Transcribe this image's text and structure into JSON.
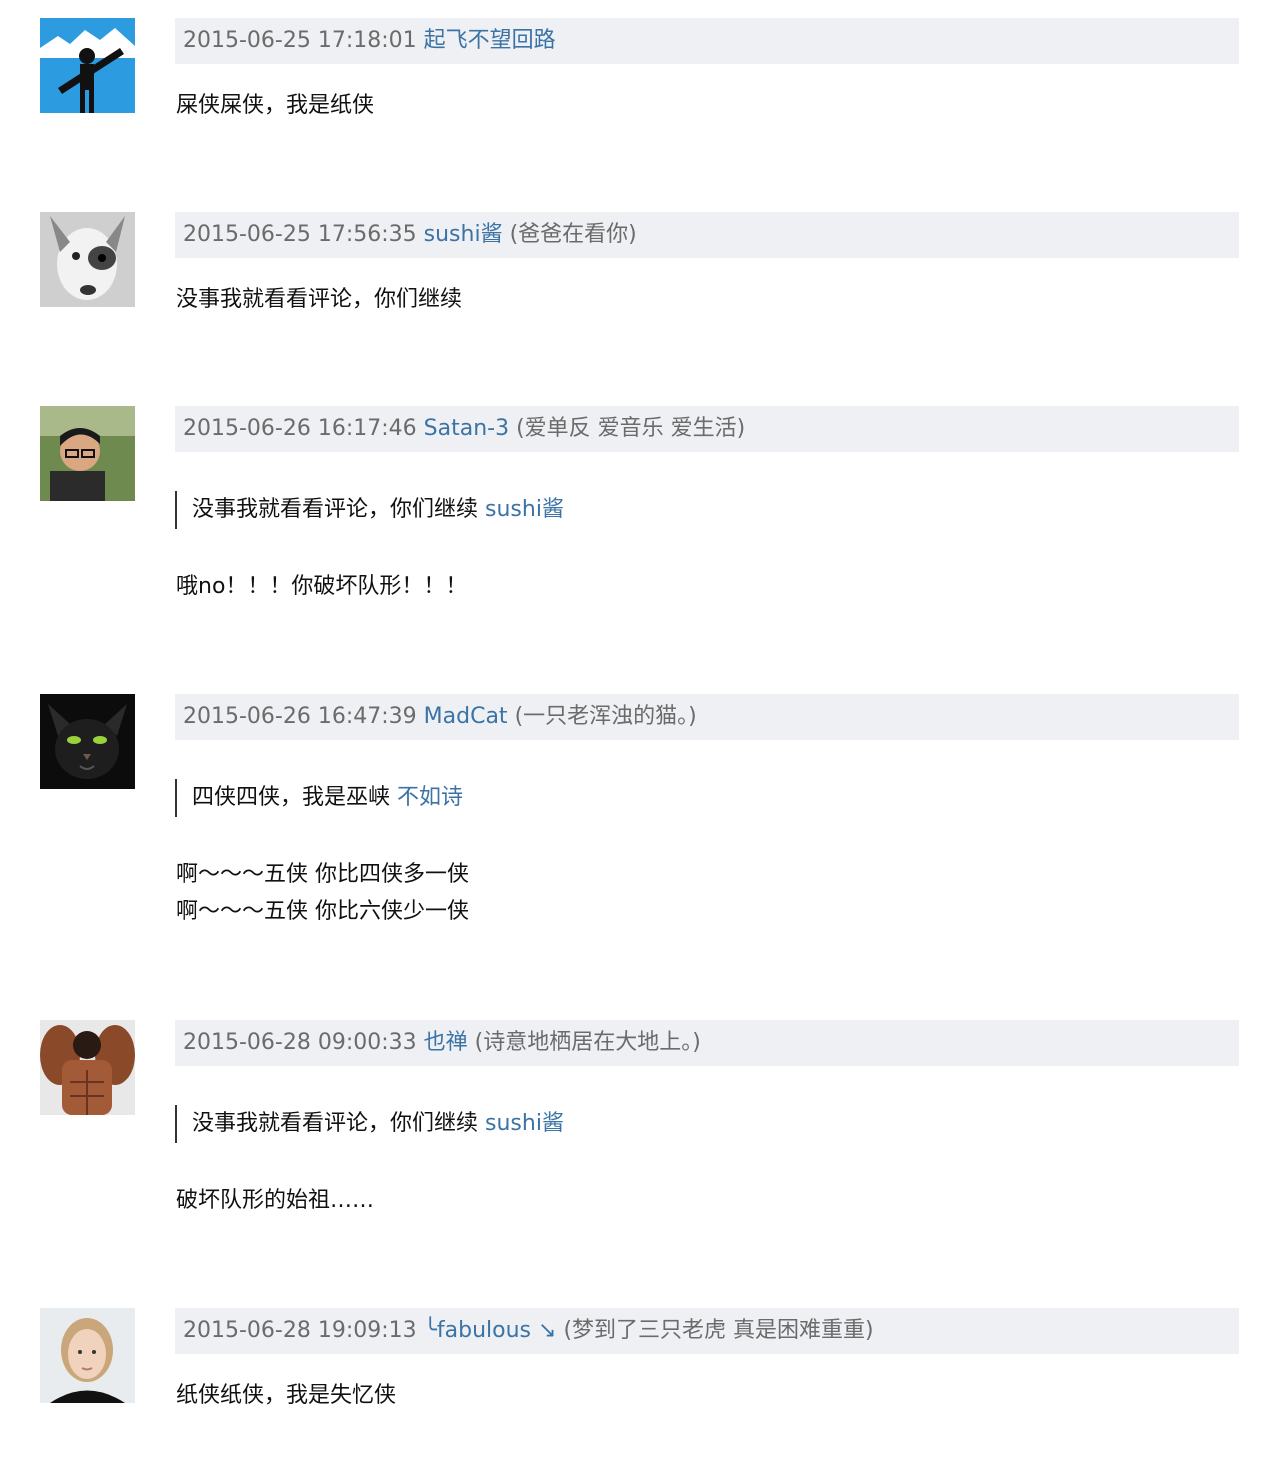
{
  "comments": [
    {
      "time": "2015-06-25 17:18:01",
      "user": "起飞不望回路",
      "signature": "",
      "avatar": "guitar-silhouette-avatar",
      "lines": [
        "屎侠屎侠，我是纸侠"
      ]
    },
    {
      "time": "2015-06-25 17:56:35",
      "user": "sushi酱",
      "signature": "(爸爸在看你)",
      "avatar": "dog-avatar",
      "lines": [
        "没事我就看看评论，你们继续"
      ]
    },
    {
      "time": "2015-06-26 16:17:46",
      "user": "Satan-3",
      "signature": "(爱单反 爱音乐 爱生活)",
      "avatar": "man-glasses-avatar",
      "quote": {
        "text": "没事我就看看评论，你们继续",
        "user": "sushi酱"
      },
      "lines": [
        "哦no！！！你破坏队形！！！"
      ]
    },
    {
      "time": "2015-06-26 16:47:39",
      "user": "MadCat",
      "signature": "(一只老浑浊的猫。)",
      "avatar": "cat-avatar",
      "quote": {
        "text": "四侠四侠，我是巫峡",
        "user": "不如诗"
      },
      "lines": [
        "啊～～～五侠 你比四侠多一侠",
        "啊～～～五侠 你比六侠少一侠"
      ]
    },
    {
      "time": "2015-06-28 09:00:33",
      "user": "也禅",
      "signature": "(诗意地栖居在大地上。)",
      "avatar": "muscle-avatar",
      "quote": {
        "text": "没事我就看看评论，你们继续",
        "user": "sushi酱"
      },
      "lines": [
        "破坏队形的始祖……"
      ]
    },
    {
      "time": "2015-06-28 19:09:13",
      "user": "╰fabulous ↘",
      "signature": "(梦到了三只老虎 真是困难重重)",
      "avatar": "woman-portrait-avatar",
      "lines": [
        "纸侠纸侠，我是失忆侠"
      ]
    }
  ]
}
